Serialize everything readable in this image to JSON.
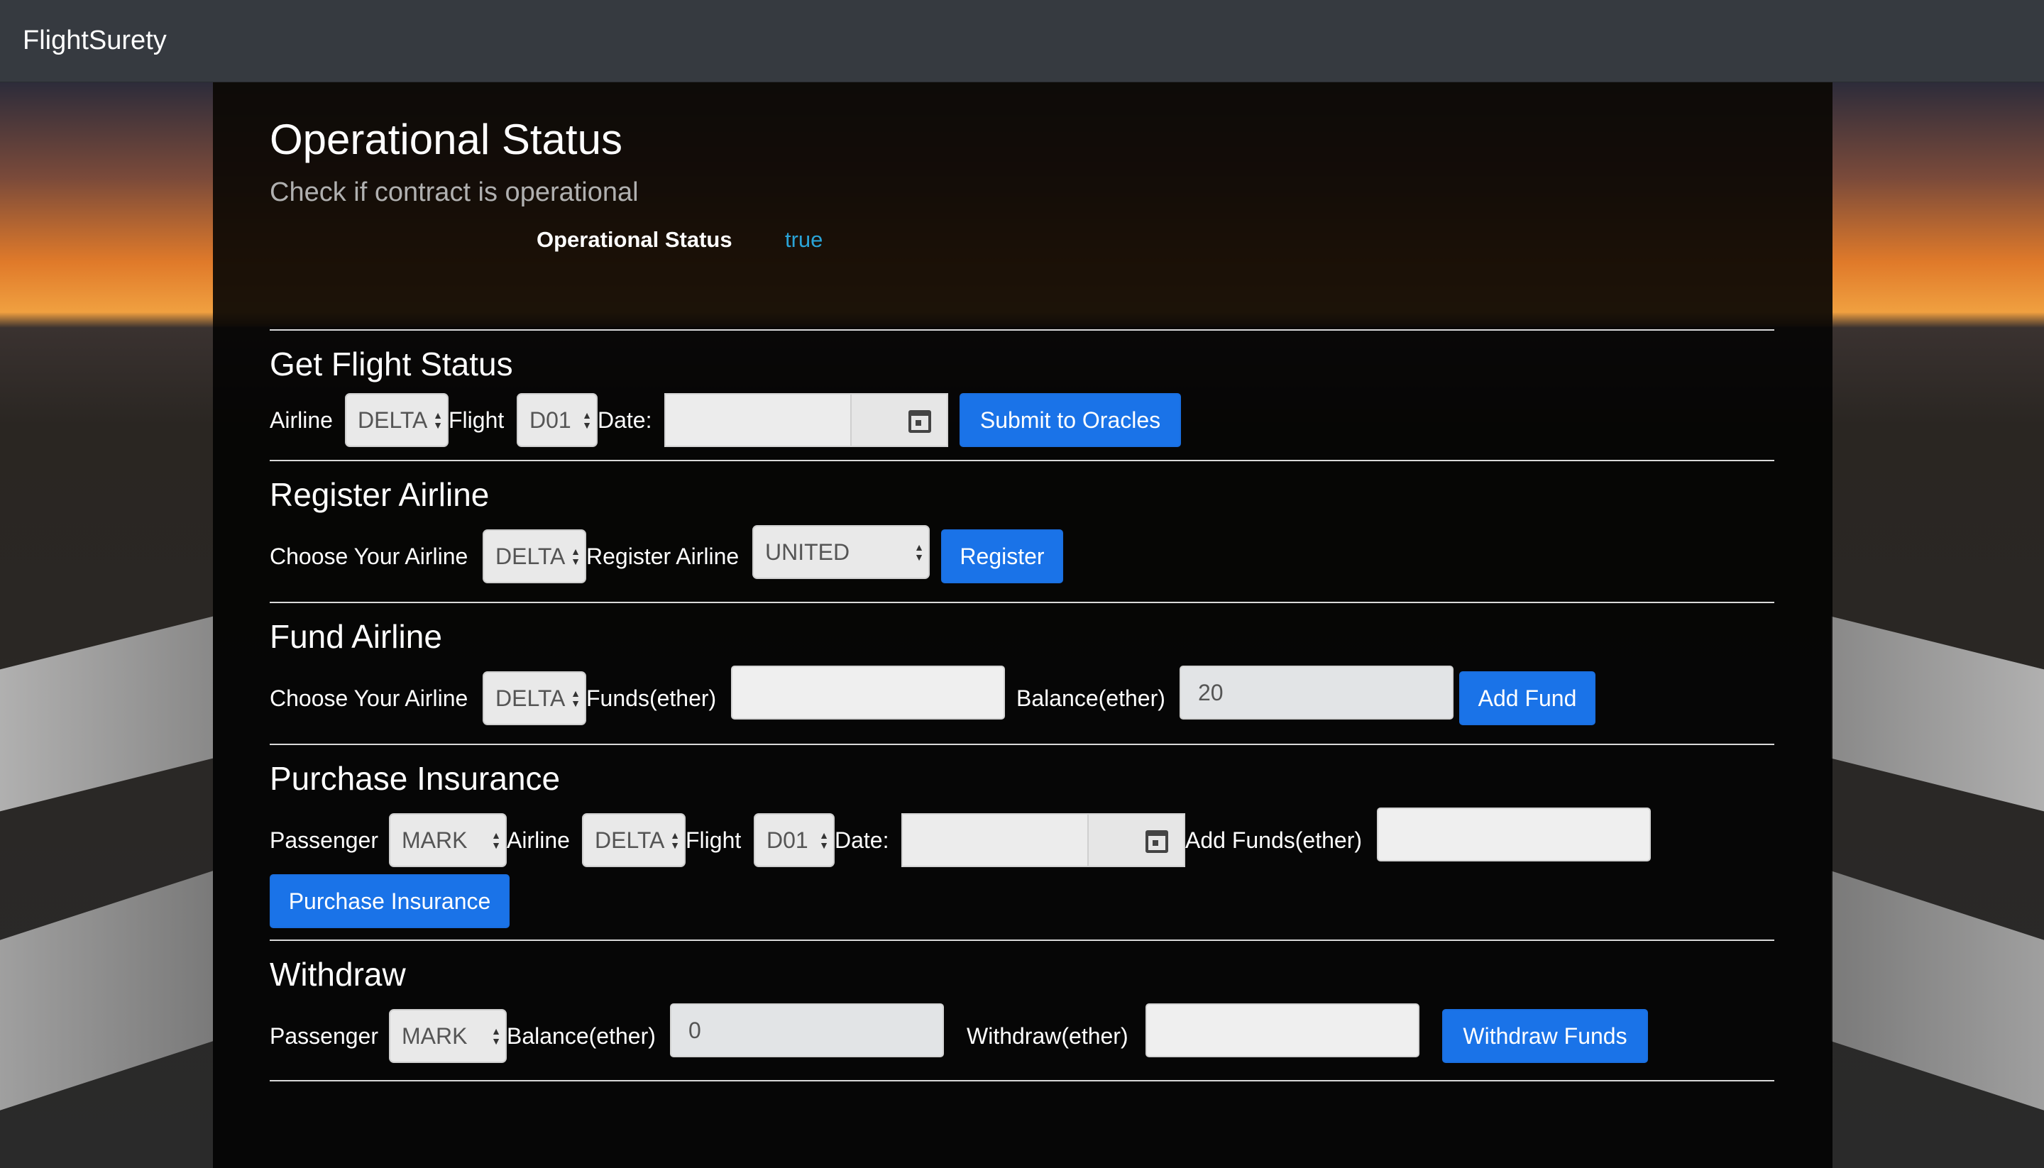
{
  "app": {
    "brand": "FlightSurety"
  },
  "operational": {
    "title": "Operational Status",
    "subtitle": "Check if contract is operational",
    "status_label": "Operational Status",
    "status_value": "true"
  },
  "flight_status": {
    "title": "Get Flight Status",
    "airline_label": "Airline",
    "airline_value": "DELTA",
    "flight_label": "Flight",
    "flight_value": "D01",
    "date_label": "Date:",
    "submit_label": "Submit to Oracles"
  },
  "register_airline": {
    "title": "Register Airline",
    "choose_label": "Choose Your Airline",
    "choose_value": "DELTA",
    "register_label": "Register Airline",
    "register_value": "UNITED",
    "button_label": "Register"
  },
  "fund_airline": {
    "title": "Fund Airline",
    "choose_label": "Choose Your Airline",
    "choose_value": "DELTA",
    "funds_label": "Funds(ether)",
    "funds_value": "",
    "balance_label": "Balance(ether)",
    "balance_value": "20",
    "button_label": "Add Fund"
  },
  "purchase_insurance": {
    "title": "Purchase Insurance",
    "passenger_label": "Passenger",
    "passenger_value": "MARK",
    "airline_label": "Airline",
    "airline_value": "DELTA",
    "flight_label": "Flight",
    "flight_value": "D01",
    "date_label": "Date:",
    "add_funds_label": "Add Funds(ether)",
    "add_funds_value": "",
    "button_label": "Purchase Insurance"
  },
  "withdraw": {
    "title": "Withdraw",
    "passenger_label": "Passenger",
    "passenger_value": "MARK",
    "balance_label": "Balance(ether)",
    "balance_value": "0",
    "withdraw_label": "Withdraw(ether)",
    "withdraw_value": "",
    "button_label": "Withdraw Funds"
  }
}
